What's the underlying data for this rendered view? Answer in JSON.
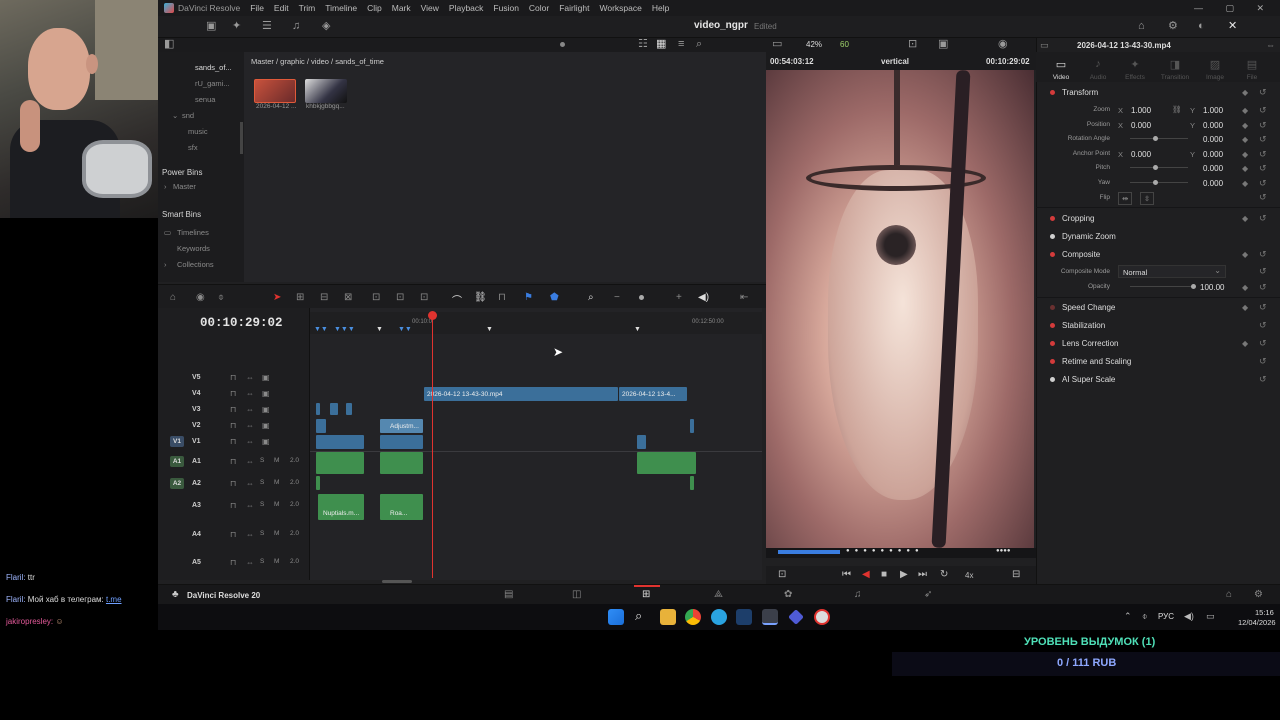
{
  "app": {
    "name": "DaVinci Resolve",
    "menu": [
      "File",
      "Edit",
      "Trim",
      "Timeline",
      "Clip",
      "Mark",
      "View",
      "Playback",
      "Fusion",
      "Color",
      "Fairlight",
      "Workspace",
      "Help"
    ],
    "project_name": "video_ngpr",
    "project_status": "Edited"
  },
  "media_pool": {
    "bins": [
      "sands_of...",
      "rU_gami...",
      "senua",
      "snd",
      "music",
      "sfx"
    ],
    "power_bins_title": "Power Bins",
    "power_bins_master": "Master",
    "smart_bins_title": "Smart Bins",
    "smart_bins": [
      "Timelines",
      "Keywords",
      "Collections"
    ],
    "breadcrumb": "Master / graphic / video / sands_of_time",
    "clips": [
      {
        "name": "2026-04-12 ..."
      },
      {
        "name": "khbkjgbbgq..."
      }
    ]
  },
  "viewer": {
    "zoom": "42%",
    "fps": "60",
    "source_timecode": "00:54:03:12",
    "timeline_name": "vertical",
    "record_timecode": "00:10:29:02",
    "speed": "4x"
  },
  "timeline": {
    "timecode": "00:10:29:02",
    "ruler_labels": [
      "00:10:0",
      "00:12:50:00"
    ],
    "video_tracks": [
      "V5",
      "V4",
      "V3",
      "V2",
      "V1"
    ],
    "audio_tracks": [
      {
        "name": "A1",
        "vol": "2.0",
        "patch": "A1"
      },
      {
        "name": "A2",
        "vol": "2.0",
        "patch": "A2"
      },
      {
        "name": "A3",
        "vol": "2.0"
      },
      {
        "name": "A4",
        "vol": "2.0"
      },
      {
        "name": "A5",
        "vol": "2.0"
      }
    ],
    "v1_patch": "V1",
    "clip_labels": {
      "v4_main": "2026-04-12 13-43-30.mp4",
      "v4_second": "2026-04-12 13-4...",
      "v2_adjust": "Adjustm...",
      "a3_clip1": "Nuptials.m...",
      "a3_clip2": "Roa..."
    },
    "mute_label": "M"
  },
  "inspector": {
    "clip_name": "2026-04-12 13-43-30.mp4",
    "tabs": [
      "Video",
      "Audio",
      "Effects",
      "Transition",
      "Image",
      "File"
    ],
    "sections": {
      "transform": "Transform",
      "cropping": "Cropping",
      "dynamic_zoom": "Dynamic Zoom",
      "composite": "Composite",
      "speed_change": "Speed Change",
      "stabilization": "Stabilization",
      "lens_correction": "Lens Correction",
      "retime": "Retime and Scaling",
      "ai_super_scale": "AI Super Scale"
    },
    "transform": {
      "zoom_label": "Zoom",
      "zoom_x": "1.000",
      "zoom_y": "1.000",
      "position_label": "Position",
      "position_x": "0.000",
      "position_y": "0.000",
      "rotation_label": "Rotation Angle",
      "rotation": "0.000",
      "anchor_label": "Anchor Point",
      "anchor_x": "0.000",
      "anchor_y": "0.000",
      "pitch_label": "Pitch",
      "pitch": "0.000",
      "yaw_label": "Yaw",
      "yaw": "0.000",
      "flip_label": "Flip",
      "x": "X",
      "y": "Y"
    },
    "composite": {
      "mode_label": "Composite Mode",
      "mode": "Normal",
      "opacity_label": "Opacity",
      "opacity": "100.00"
    }
  },
  "pagebar": {
    "label": "DaVinci Resolve 20"
  },
  "taskbar": {
    "lang": "РУС",
    "time": "15:16",
    "date": "12/04/2026"
  },
  "chat": [
    {
      "user": "Flaril:",
      "text": "ttr",
      "link": ""
    },
    {
      "user": "Flaril:",
      "text": "Мой хаб в телеграм: ",
      "link": "t.me"
    },
    {
      "user": "jakiropresley:",
      "text": "",
      "link": ""
    }
  ],
  "overlay": {
    "level": "УРОВЕНЬ ВЫДУМОК (1)",
    "donation": "0 / 111 RUB"
  },
  "colors": {
    "accent_red": "#e0332f",
    "video_clip": "#3b6f9a",
    "audio_clip": "#3f8f4e",
    "level_text": "#4fe0b8"
  }
}
